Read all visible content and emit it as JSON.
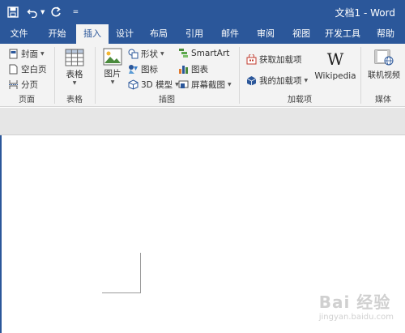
{
  "titlebar": {
    "doc_title": "文档1 - Word"
  },
  "tabs": [
    {
      "label": "文件",
      "active": false
    },
    {
      "label": "开始",
      "active": false
    },
    {
      "label": "插入",
      "active": true
    },
    {
      "label": "设计",
      "active": false
    },
    {
      "label": "布局",
      "active": false
    },
    {
      "label": "引用",
      "active": false
    },
    {
      "label": "邮件",
      "active": false
    },
    {
      "label": "审阅",
      "active": false
    },
    {
      "label": "视图",
      "active": false
    },
    {
      "label": "开发工具",
      "active": false
    },
    {
      "label": "帮助",
      "active": false
    }
  ],
  "ribbon": {
    "pages": {
      "cover": "封面",
      "blank": "空白页",
      "break": "分页",
      "label": "页面"
    },
    "tables": {
      "table": "表格",
      "label": "表格"
    },
    "illustrations": {
      "pictures": "图片",
      "shapes": "形状",
      "icons": "图标",
      "model3d": "3D 模型",
      "smartart": "SmartArt",
      "chart": "图表",
      "screenshot": "屏幕截图",
      "label": "插图"
    },
    "addins": {
      "get": "获取加载项",
      "mine": "我的加载项",
      "wikipedia": "Wikipedia",
      "wiki_glyph": "W",
      "label": "加载项"
    },
    "media": {
      "online_video": "联机视频",
      "label": "媒体"
    }
  },
  "watermark": {
    "main": "Bai 经验",
    "sub": "jingyan.baidu.com"
  },
  "colors": {
    "accent": "#2b579a",
    "ribbon_bg": "#f3f3f3",
    "band_bg": "#e6e6e6"
  }
}
